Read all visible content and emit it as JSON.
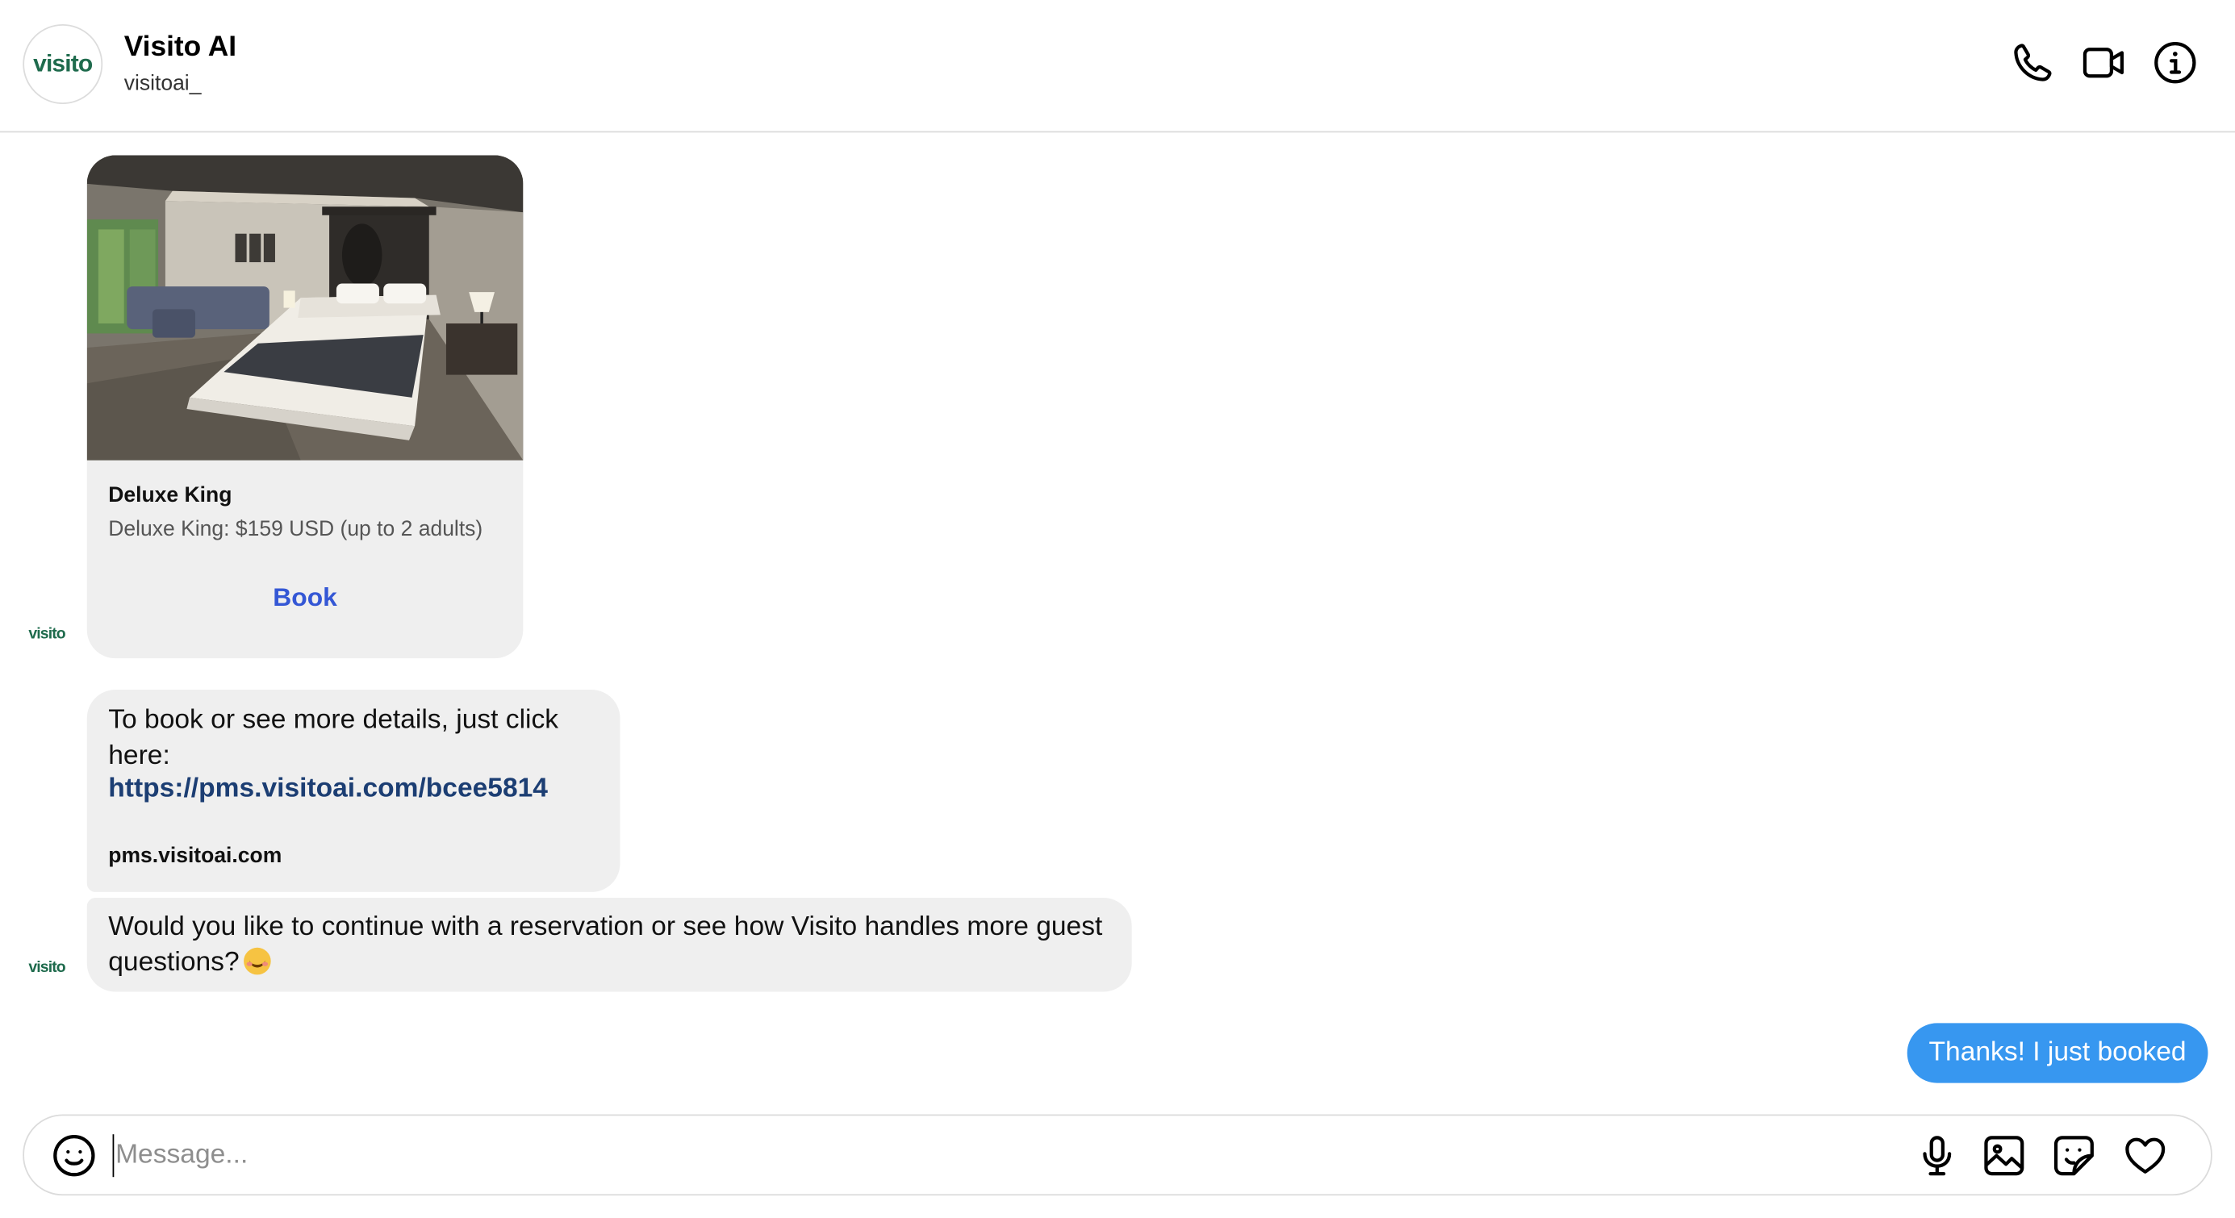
{
  "header": {
    "logo_text": "visito",
    "contact_name": "Visito AI",
    "contact_handle": "visitoai_",
    "icons": [
      "phone-icon",
      "video-camera-icon",
      "info-icon"
    ]
  },
  "messages": {
    "avatar_logo": "visito",
    "card": {
      "title": "Deluxe King",
      "subtitle": "Deluxe King: $159 USD (up to 2 adults)",
      "button_label": "Book"
    },
    "link_message": {
      "text": "To book or see more details, just click here:",
      "link": "https://pms.visitoai.com/bcee5814",
      "domain": "pms.visitoai.com"
    },
    "question_message": {
      "text": "Would you like to continue with a reservation or see how Visito handles more guest questions?"
    },
    "sent_message": {
      "text": "Thanks! I just booked"
    }
  },
  "composer": {
    "placeholder": "Message...",
    "value": "",
    "icons": [
      "emoji-icon",
      "microphone-icon",
      "image-icon",
      "sticker-icon",
      "heart-icon"
    ]
  },
  "colors": {
    "sent_bubble": "#3797f0",
    "received_bubble": "#efefef",
    "link": "#1c3e73",
    "book_button": "#3457d5",
    "brand_green": "#1f6b4d"
  }
}
